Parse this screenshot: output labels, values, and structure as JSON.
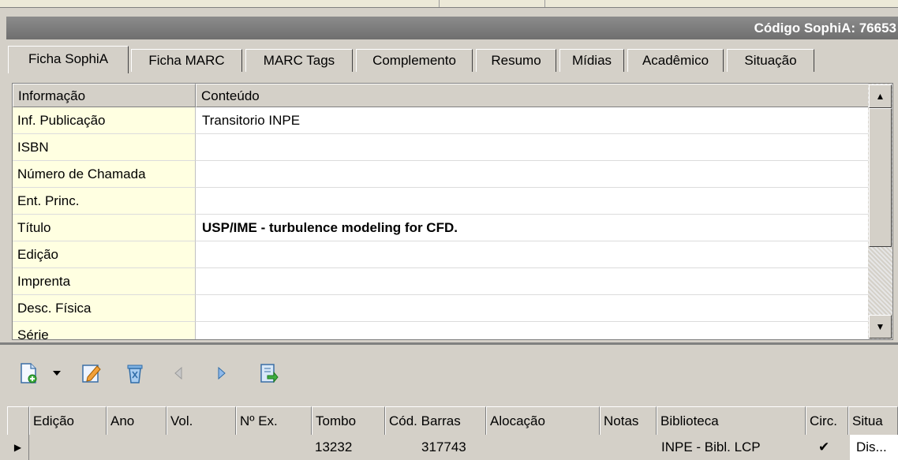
{
  "header": {
    "code_label": "Código SophiA: 76653"
  },
  "tabs": [
    {
      "label": "Ficha SophiA"
    },
    {
      "label": "Ficha MARC"
    },
    {
      "label": "MARC Tags"
    },
    {
      "label": "Complemento"
    },
    {
      "label": "Resumo"
    },
    {
      "label": "Mídias"
    },
    {
      "label": "Acadêmico"
    },
    {
      "label": "Situação"
    }
  ],
  "record_grid": {
    "columns": [
      "Informação",
      "Conteúdo"
    ],
    "rows": [
      {
        "field": "Inf. Publicação",
        "value": "Transitorio INPE"
      },
      {
        "field": "ISBN",
        "value": ""
      },
      {
        "field": "Número de Chamada",
        "value": ""
      },
      {
        "field": "Ent. Princ.",
        "value": ""
      },
      {
        "field": "Título",
        "value": "USP/IME - turbulence modeling for CFD."
      },
      {
        "field": "Edição",
        "value": ""
      },
      {
        "field": "Imprenta",
        "value": ""
      },
      {
        "field": "Desc. Física",
        "value": ""
      },
      {
        "field": "Série",
        "value": ""
      }
    ]
  },
  "toolbar": {
    "icons": [
      "new-document-icon",
      "dropdown-arrow-icon",
      "edit-icon",
      "delete-icon",
      "previous-icon",
      "next-icon",
      "export-icon"
    ]
  },
  "items_grid": {
    "columns": [
      "Edição",
      "Ano",
      "Vol.",
      "Nº Ex.",
      "Tombo",
      "Cód. Barras",
      "Alocação",
      "Notas",
      "Biblioteca",
      "Circ.",
      "Situa"
    ],
    "rows": [
      {
        "edicao": "",
        "ano": "",
        "vol": "",
        "n_ex": "",
        "tombo": "13232",
        "cod_barras": "317743",
        "alocacao": "",
        "notas": "",
        "biblioteca": "INPE - Bibl. LCP",
        "circ": "✔",
        "situacao": "Dis..."
      }
    ]
  },
  "colors": {
    "label_bg": "#ffffe1",
    "chrome": "#d4d0c8",
    "codebar": "#7f7f7f"
  }
}
